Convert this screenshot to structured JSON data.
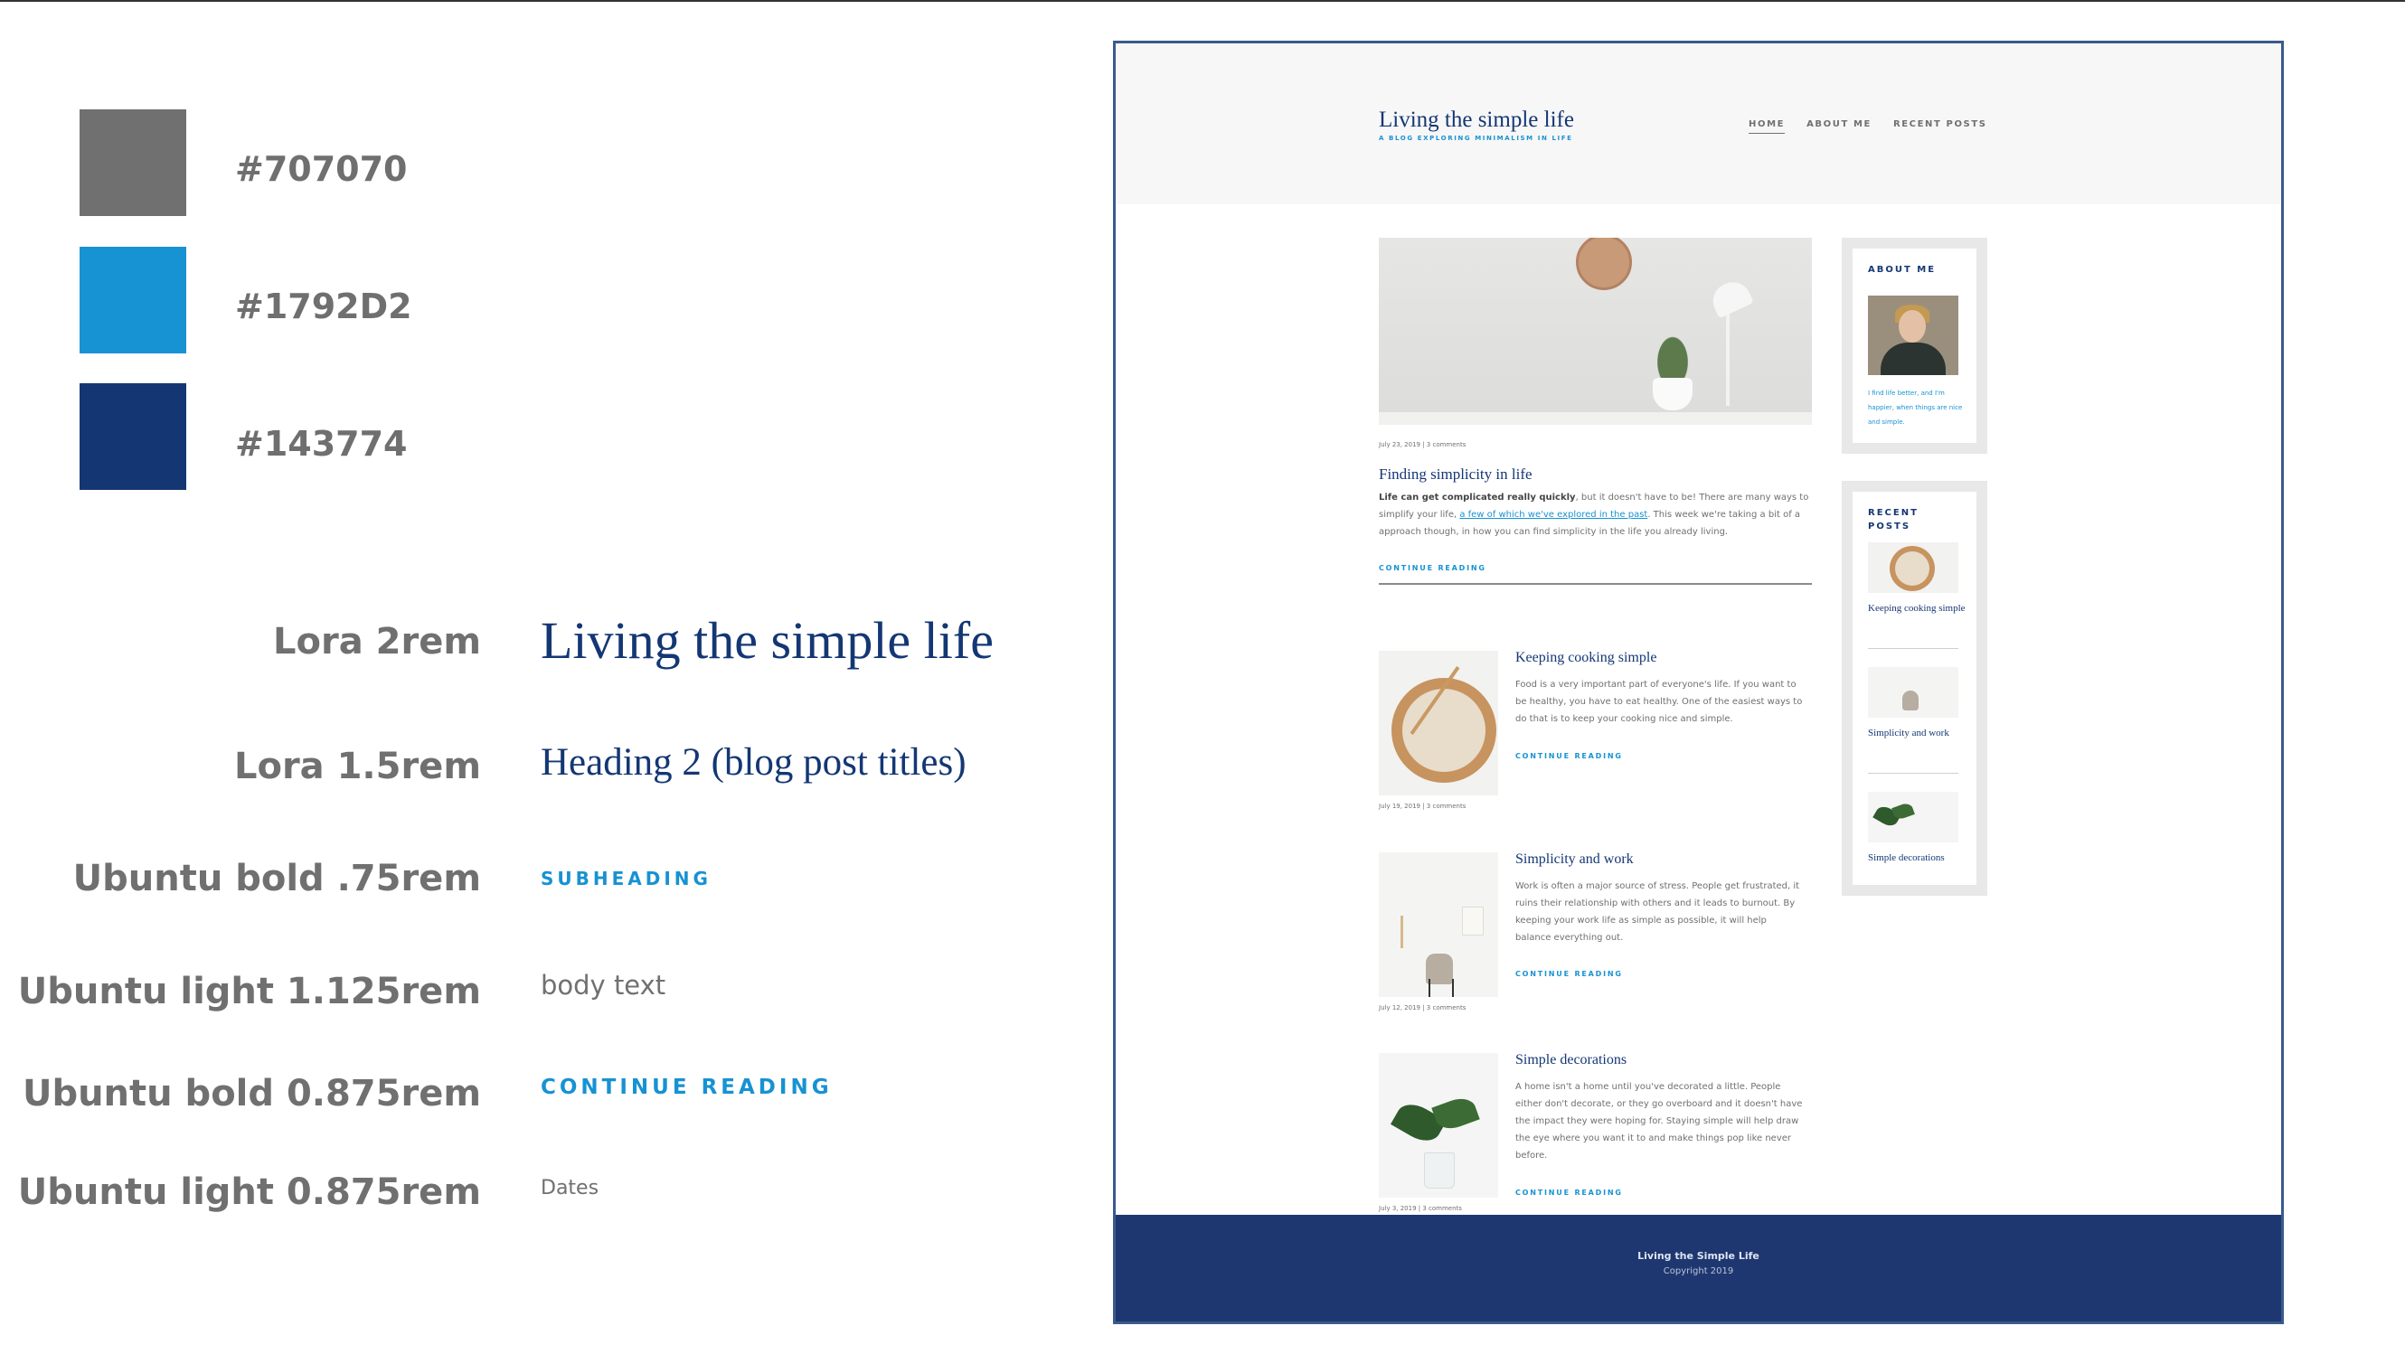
{
  "palette": [
    {
      "label": "#707070",
      "color": "#707070"
    },
    {
      "label": "#1792D2",
      "color": "#1792D2"
    },
    {
      "label": "#143774",
      "color": "#143774"
    }
  ],
  "type_specs": [
    {
      "label": "Lora 2rem",
      "sample": "Living the simple life"
    },
    {
      "label": "Lora 1.5rem",
      "sample": "Heading 2 (blog post titles)"
    },
    {
      "label": "Ubuntu bold .75rem",
      "sample": "SUBHEADING"
    },
    {
      "label": "Ubuntu light 1.125rem",
      "sample": "body text"
    },
    {
      "label": "Ubuntu bold 0.875rem",
      "sample": "CONTINUE READING"
    },
    {
      "label": "Ubuntu light 0.875rem",
      "sample": "Dates"
    }
  ],
  "site": {
    "title": "Living the simple life",
    "tagline": "A BLOG EXPLORING MINIMALISM IN LIFE",
    "nav": [
      "HOME",
      "ABOUT ME",
      "RECENT POSTS"
    ],
    "active_nav": "HOME"
  },
  "featured": {
    "meta": "July 23, 2019  |  3 comments",
    "title": "Finding simplicity in life",
    "excerpt_bold": "Life can get complicated really quickly",
    "excerpt_part1": ", but it doesn't have to be! There are many ways to simplify your life, ",
    "excerpt_link": "a few of which we've explored in the past",
    "excerpt_part2": ". This week we're taking a bit of a approach though, in how you can find simplicity in the life you already living.",
    "continue": "CONTINUE READING"
  },
  "posts": [
    {
      "title": "Keeping cooking simple",
      "excerpt": "Food is a very important part of everyone's life. If you want to be healthy, you have to eat healthy. One of the easiest ways to do that is to keep your cooking nice and simple.",
      "continue": "CONTINUE READING",
      "meta": "July 19, 2019  |  3 comments"
    },
    {
      "title": "Simplicity and work",
      "excerpt": "Work is often a major source of stress. People get frustrated, it ruins their relationship with others and it leads to burnout. By keeping your work life as simple as possible, it will help balance everything out.",
      "continue": "CONTINUE READING",
      "meta": "July 12, 2019  |  3 comments"
    },
    {
      "title": "Simple decorations",
      "excerpt": "A home isn't a home until you've decorated a little. People either don't decorate, or they go overboard and it doesn't have the impact they were hoping for. Staying simple will help draw the eye where you want it to and make things pop like never before.",
      "continue": "CONTINUE READING",
      "meta": "July 3, 2019  |  3 comments"
    }
  ],
  "sidebar": {
    "about_heading": "ABOUT ME",
    "about_text": "I find life better, and I'm happier, when things are nice and simple.",
    "recent_heading": "RECENT POSTS",
    "recent": [
      "Keeping cooking simple",
      "Simplicity and work",
      "Simple decorations"
    ]
  },
  "footer": {
    "title": "Living the Simple Life",
    "copyright": "Copyright 2019"
  }
}
